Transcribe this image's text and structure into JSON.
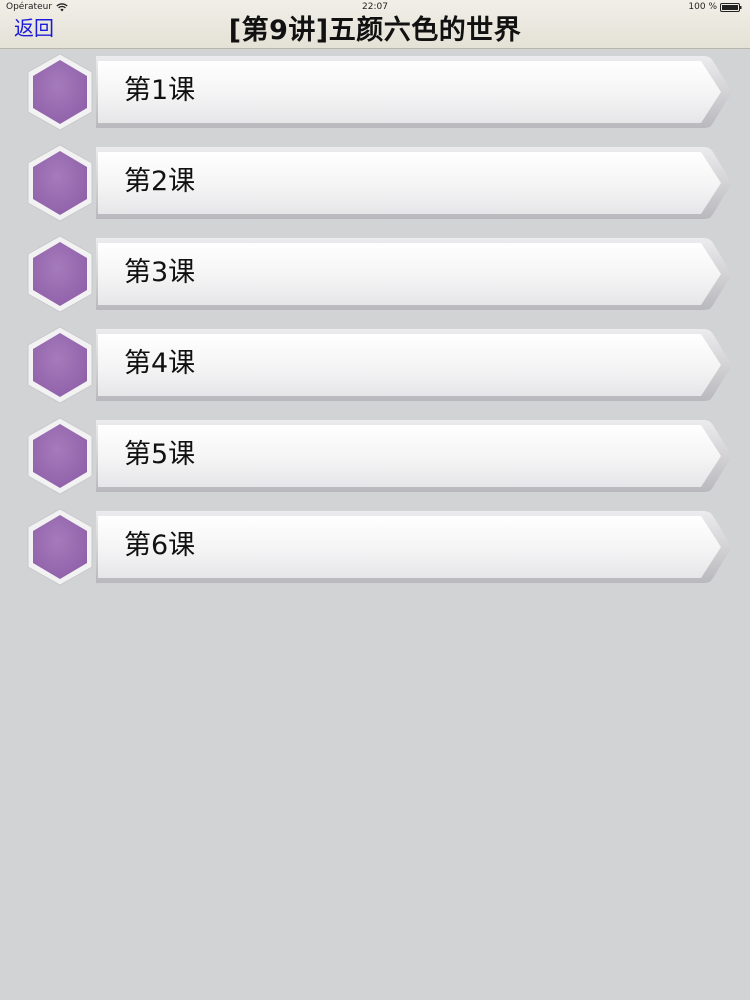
{
  "status_bar": {
    "carrier": "Opérateur",
    "time": "22:07",
    "battery": "100 %"
  },
  "nav": {
    "back_label": "返回",
    "title": "[第9讲]五颜六色的世界"
  },
  "lessons": [
    {
      "label": "第1课"
    },
    {
      "label": "第2课"
    },
    {
      "label": "第3课"
    },
    {
      "label": "第4课"
    },
    {
      "label": "第5课"
    },
    {
      "label": "第6课"
    }
  ],
  "colors": {
    "hexagon": "#9b6cb2",
    "back_link": "#1a1ad9",
    "background": "#d2d3d4"
  },
  "icons": {
    "status_wifi": "wifi-icon",
    "status_battery": "battery-icon",
    "lesson_marker": "hexagon-icon"
  }
}
